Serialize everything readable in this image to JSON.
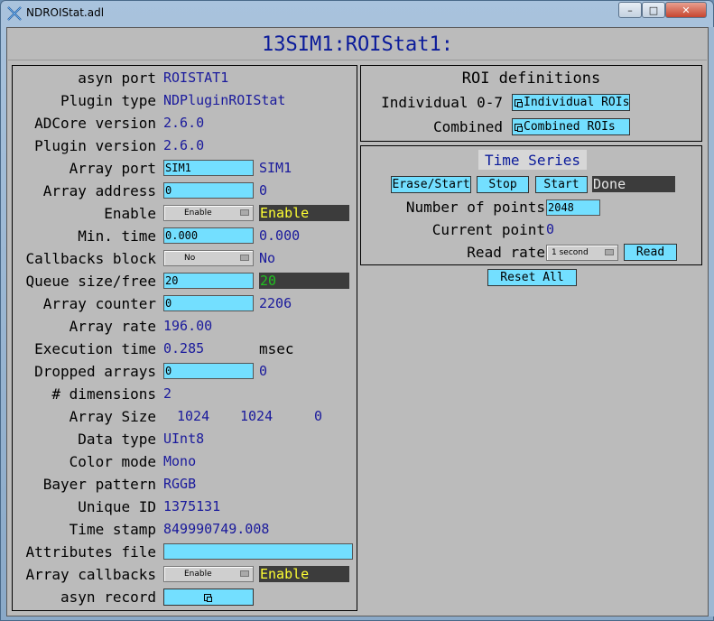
{
  "window": {
    "title": "NDROIStat.adl"
  },
  "header": {
    "title": "13SIM1:ROIStat1:"
  },
  "left": {
    "asyn_port": {
      "label": "asyn port",
      "value": "ROISTAT1"
    },
    "plugin_type": {
      "label": "Plugin type",
      "value": "NDPluginROIStat"
    },
    "adcore_version": {
      "label": "ADCore version",
      "value": "2.6.0"
    },
    "plugin_version": {
      "label": "Plugin version",
      "value": "2.6.0"
    },
    "array_port": {
      "label": "Array port",
      "input": "SIM1",
      "readback": "SIM1"
    },
    "array_address": {
      "label": "Array address",
      "input": "0",
      "readback": "0"
    },
    "enable": {
      "label": "Enable",
      "menu": "Enable",
      "readback": "Enable"
    },
    "min_time": {
      "label": "Min. time",
      "input": "0.000",
      "readback": "0.000"
    },
    "callbacks_block": {
      "label": "Callbacks block",
      "menu": "No",
      "readback": "No"
    },
    "queue": {
      "label": "Queue size/free",
      "input": "20",
      "readback": "20"
    },
    "array_counter": {
      "label": "Array counter",
      "input": "0",
      "readback": "2206"
    },
    "array_rate": {
      "label": "Array rate",
      "value": "196.00"
    },
    "execution_time": {
      "label": "Execution time",
      "value": "0.285",
      "unit": "msec"
    },
    "dropped_arrays": {
      "label": "Dropped arrays",
      "input": "0",
      "readback": "0"
    },
    "dimensions": {
      "label": "# dimensions",
      "value": "2"
    },
    "array_size": {
      "label": "Array Size",
      "x": "1024",
      "y": "1024",
      "z": "0"
    },
    "data_type": {
      "label": "Data type",
      "value": "UInt8"
    },
    "color_mode": {
      "label": "Color mode",
      "value": "Mono"
    },
    "bayer_pattern": {
      "label": "Bayer pattern",
      "value": "RGGB"
    },
    "unique_id": {
      "label": "Unique ID",
      "value": "1375131"
    },
    "time_stamp": {
      "label": "Time stamp",
      "value": "849990749.008"
    },
    "attributes_file": {
      "label": "Attributes file",
      "input": ""
    },
    "array_callbacks": {
      "label": "Array callbacks",
      "menu": "Enable",
      "readback": "Enable"
    },
    "asyn_record": {
      "label": "asyn record"
    }
  },
  "roi": {
    "title": "ROI definitions",
    "individual_label": "Individual 0-7",
    "individual_button": "Individual ROIs",
    "combined_label": "Combined",
    "combined_button": "Combined ROIs"
  },
  "time_series": {
    "title": "Time Series",
    "erase_start": "Erase/Start",
    "stop": "Stop",
    "start": "Start",
    "status": "Done",
    "num_points_label": "Number of points",
    "num_points": "2048",
    "current_point_label": "Current point",
    "current_point": "0",
    "read_rate_label": "Read rate",
    "read_rate_menu": "1 second",
    "read_button": "Read"
  },
  "reset_all": "Reset All"
}
